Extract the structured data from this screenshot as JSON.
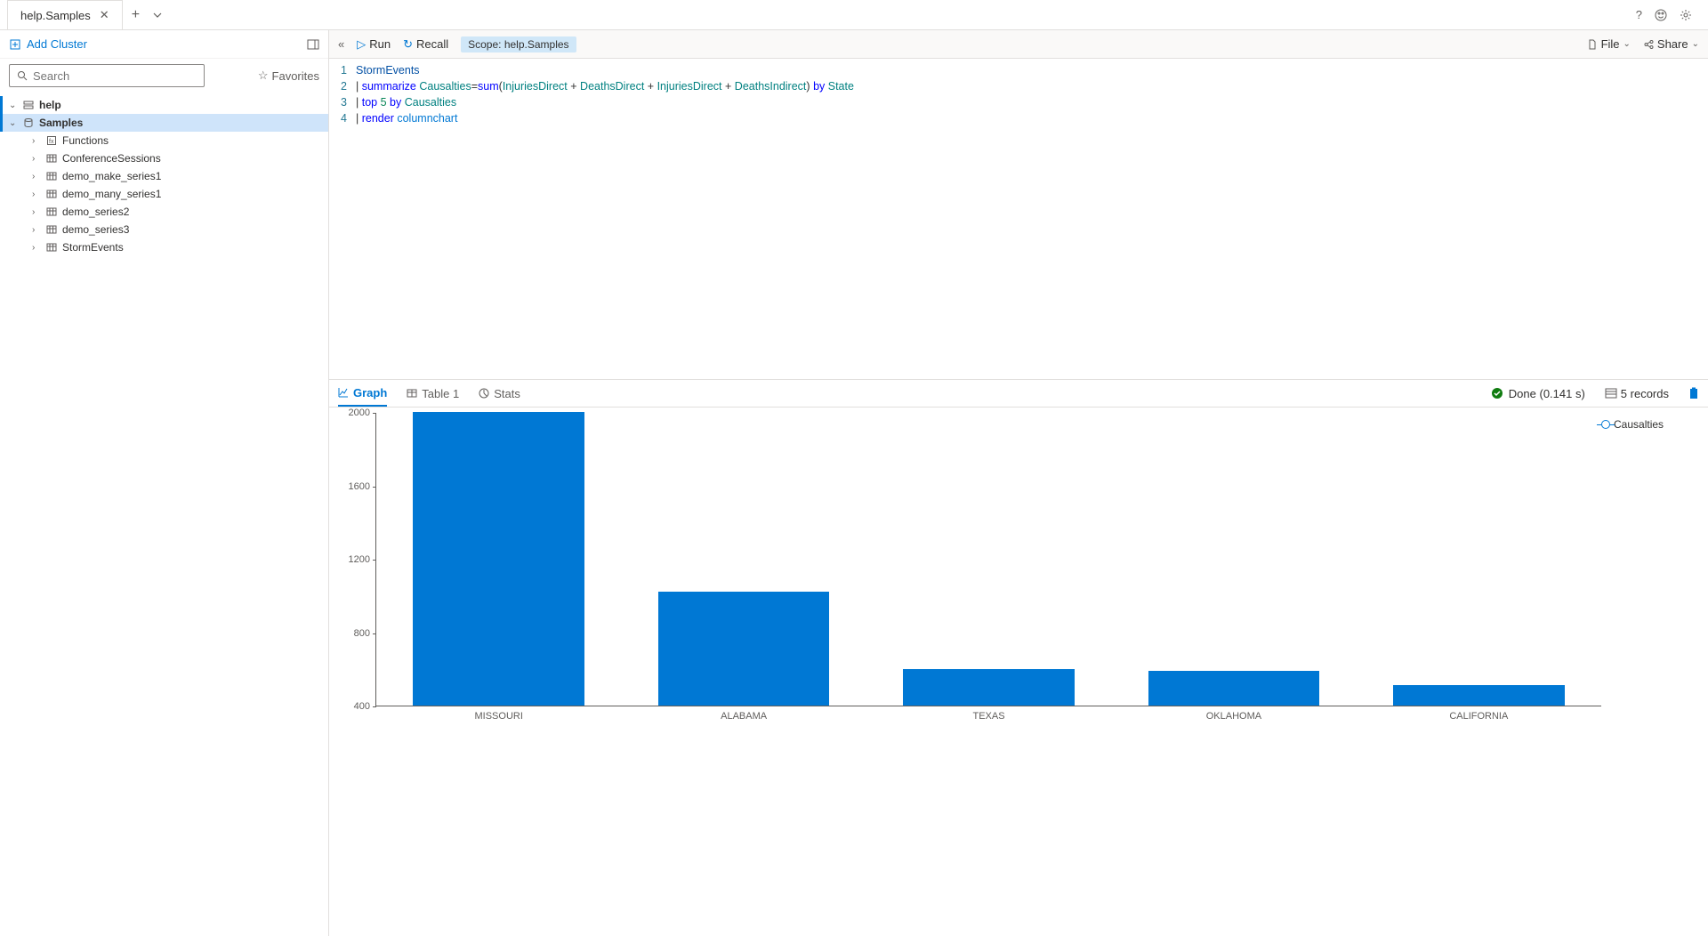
{
  "tab": {
    "title": "help.Samples"
  },
  "sidebar": {
    "add_cluster": "Add Cluster",
    "search_placeholder": "Search",
    "favorites": "Favorites",
    "tree": {
      "help": "help",
      "samples": "Samples",
      "items": [
        "Functions",
        "ConferenceSessions",
        "demo_make_series1",
        "demo_many_series1",
        "demo_series2",
        "demo_series3",
        "StormEvents"
      ]
    }
  },
  "toolbar": {
    "run": "Run",
    "recall": "Recall",
    "scope_label": "Scope:",
    "scope_value": "help.Samples",
    "file": "File",
    "share": "Share"
  },
  "editor": {
    "lines": [
      "1",
      "2",
      "3",
      "4"
    ]
  },
  "results": {
    "tabs": {
      "graph": "Graph",
      "table": "Table 1",
      "stats": "Stats"
    },
    "status": "Done (0.141 s)",
    "records": "5 records",
    "legend": "Causalties"
  },
  "chart_data": {
    "type": "bar",
    "categories": [
      "MISSOURI",
      "ALABAMA",
      "TEXAS",
      "OKLAHOMA",
      "CALIFORNIA"
    ],
    "values": [
      2000,
      1020,
      600,
      590,
      510
    ],
    "ylabel": "",
    "xlabel": "",
    "ylim": [
      400,
      2000
    ],
    "yticks": [
      400,
      800,
      1200,
      1600,
      2000
    ],
    "series_name": "Causalties"
  }
}
